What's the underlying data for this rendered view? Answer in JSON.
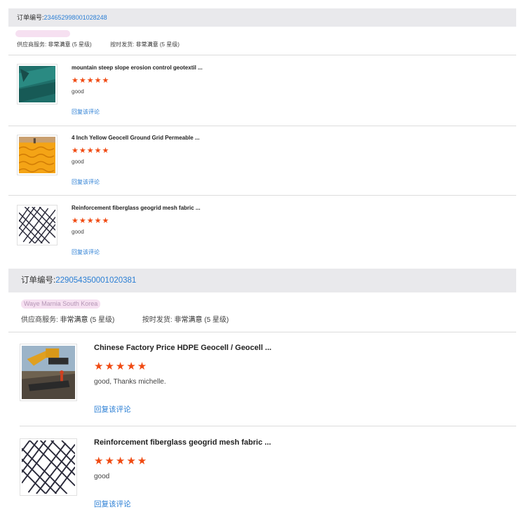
{
  "orders": [
    {
      "order_label": "订单编号:",
      "order_number": "234652998001028248",
      "ratings": {
        "supplier_service_label": "供应商服务:",
        "supplier_service_value": "非常满意",
        "supplier_service_stars": "(5 星级)",
        "on_time_label": "按时发货:",
        "on_time_value": "非常满意",
        "on_time_stars": "(5 星级)"
      },
      "items": [
        {
          "title": "mountain steep slope erosion control geotextil ...",
          "stars": "★★★★★",
          "comment": "good",
          "reply": "回复该评论",
          "image": "green-geotextile"
        },
        {
          "title": "4 Inch Yellow Geocell Ground Grid Permeable ...",
          "stars": "★★★★★",
          "comment": "good",
          "reply": "回复该评论",
          "image": "yellow-geocell"
        },
        {
          "title": "Reinforcement fiberglass geogrid mesh fabric ...",
          "stars": "★★★★★",
          "comment": "good",
          "reply": "回复该评论",
          "image": "geogrid-mesh"
        }
      ]
    },
    {
      "order_label": "订单编号:",
      "order_number": "229054350001020381",
      "buyer_location": "Waye Marnia South Korea",
      "ratings": {
        "supplier_service_label": "供应商服务:",
        "supplier_service_value": "非常满意",
        "supplier_service_stars": "(5 星级)",
        "on_time_label": "按时发货:",
        "on_time_value": "非常满意",
        "on_time_stars": "(5 星级)"
      },
      "items": [
        {
          "title": "Chinese Factory Price HDPE Geocell / Geocell ...",
          "stars": "★★★★★",
          "comment": "good, Thanks michelle.",
          "reply": "回复该评论",
          "image": "excavator-geocell"
        },
        {
          "title": "Reinforcement fiberglass geogrid mesh fabric ...",
          "stars": "★★★★★",
          "comment": "good",
          "reply": "回复该评论",
          "image": "geogrid-mesh"
        }
      ]
    }
  ],
  "colors": {
    "link": "#2a7ed4",
    "star": "#f04a12",
    "header_bg": "#e9e9ec"
  }
}
